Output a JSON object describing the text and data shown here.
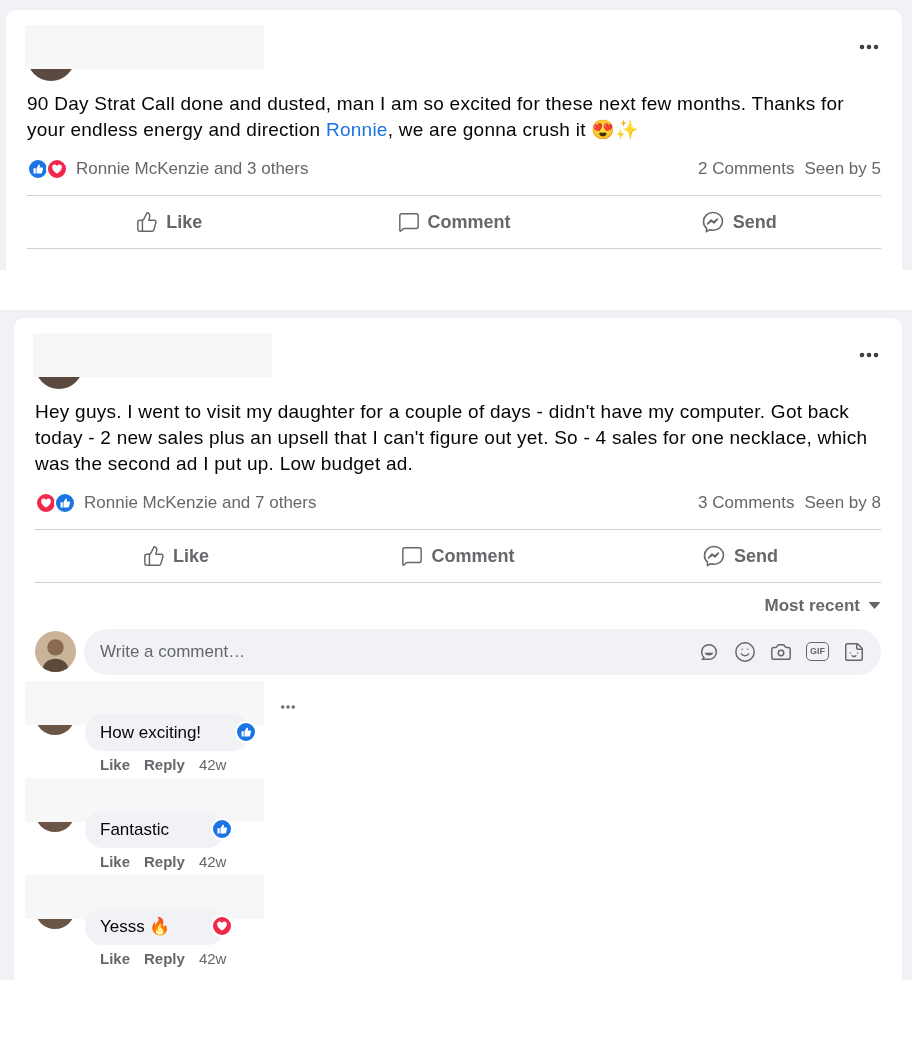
{
  "posts": [
    {
      "body": [
        {
          "kind": "text",
          "text": "90 Day Strat Call done and dusted, man I am so excited for these next few months. Thanks for your endless energy and direction "
        },
        {
          "kind": "link",
          "text": "Ronnie"
        },
        {
          "kind": "text",
          "text": ", we are gonna crush it 😍✨"
        }
      ],
      "reactions": [
        {
          "kind": "like"
        },
        {
          "kind": "love"
        }
      ],
      "reacted_by": "Ronnie McKenzie and 3 others",
      "comments_count": "2 Comments",
      "seen_by": "Seen by 5",
      "actions": [
        {
          "kind": "like",
          "label": "Like"
        },
        {
          "kind": "comment",
          "label": "Comment"
        },
        {
          "kind": "send",
          "label": "Send"
        }
      ],
      "clipped": true
    },
    {
      "body": [
        {
          "kind": "text",
          "text": "Hey guys. I went to visit my daughter for a couple of days - didn't have my computer. Got back today - 2 new sales plus an upsell that I can't figure out yet. So - 4 sales for one necklace, which was the second ad I put up. Low budget ad."
        }
      ],
      "reactions": [
        {
          "kind": "love"
        },
        {
          "kind": "like"
        }
      ],
      "reacted_by": "Ronnie McKenzie and 7 others",
      "comments_count": "3 Comments",
      "seen_by": "Seen by 8",
      "actions": [
        {
          "kind": "like",
          "label": "Like"
        },
        {
          "kind": "comment",
          "label": "Comment"
        },
        {
          "kind": "send",
          "label": "Send"
        }
      ],
      "clipped": false,
      "sort": "Most recent",
      "composer": {
        "placeholder": "Write a comment…",
        "gif_label": "GIF"
      },
      "comments": [
        {
          "text": "How exciting!",
          "reaction": {
            "kind": "like"
          },
          "like": "Like",
          "reply": "Reply",
          "age": "42w",
          "menu": true
        },
        {
          "text": "Fantastic",
          "reaction": {
            "kind": "like"
          },
          "like": "Like",
          "reply": "Reply",
          "age": "42w",
          "menu": false
        },
        {
          "text": "Yesss 🔥",
          "reaction": {
            "kind": "love"
          },
          "like": "Like",
          "reply": "Reply",
          "age": "42w",
          "menu": false
        }
      ]
    }
  ]
}
